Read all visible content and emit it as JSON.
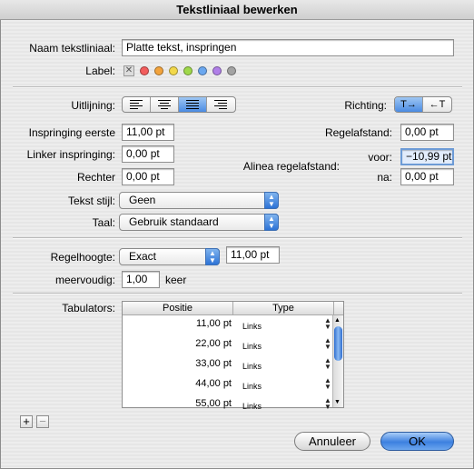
{
  "window": {
    "title": "Tekstliniaal bewerken"
  },
  "name": {
    "label": "Naam tekstliniaal:",
    "value": "Platte tekst, inspringen"
  },
  "label_row": {
    "label": "Label:",
    "colors": [
      "#f25c5c",
      "#f2a33c",
      "#f2d84a",
      "#9fd84a",
      "#6aa7ef",
      "#b07fe8",
      "#a3a3a3"
    ]
  },
  "alignment": {
    "label": "Uitlijning:",
    "selected": "justify"
  },
  "direction": {
    "label": "Richting:",
    "ltr": "T→",
    "rtl": "←T"
  },
  "indent": {
    "first_label": "Inspringing eerste",
    "first_value": "11,00 pt",
    "left_label": "Linker inspringing:",
    "left_value": "0,00 pt",
    "right_label": "Rechter",
    "right_value": "0,00 pt"
  },
  "spacing": {
    "line_label": "Regelafstand:",
    "line_value": "0,00 pt",
    "para_label": "Alinea regelafstand:",
    "before_label": "voor:",
    "before_value": "−10,99 pt",
    "after_label": "na:",
    "after_value": "0,00 pt"
  },
  "style": {
    "label": "Tekst stijl:",
    "value": "Geen"
  },
  "language": {
    "label": "Taal:",
    "value": "Gebruik standaard"
  },
  "line_height": {
    "label": "Regelhoogte:",
    "mode": "Exact",
    "value": "11,00 pt"
  },
  "multiple": {
    "label": "meervoudig:",
    "value": "1,00",
    "unit": "keer"
  },
  "tabs": {
    "label": "Tabulators:",
    "col_position": "Positie",
    "col_type": "Type",
    "rows": [
      {
        "position": "11,00 pt",
        "type": "Links"
      },
      {
        "position": "22,00 pt",
        "type": "Links"
      },
      {
        "position": "33,00 pt",
        "type": "Links"
      },
      {
        "position": "44,00 pt",
        "type": "Links"
      },
      {
        "position": "55,00 pt",
        "type": "Links"
      }
    ]
  },
  "buttons": {
    "add": "+",
    "remove": "−",
    "cancel": "Annuleer",
    "ok": "OK"
  }
}
